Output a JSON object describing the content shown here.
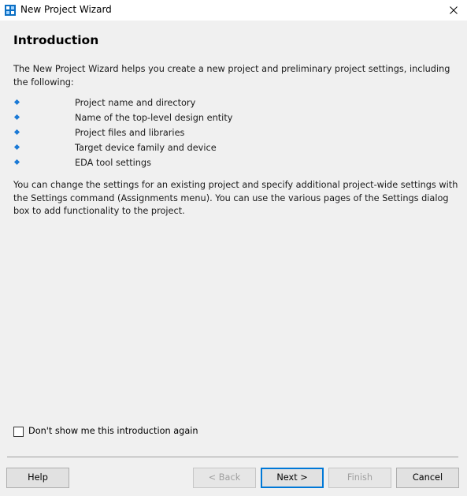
{
  "window": {
    "title": "New Project Wizard"
  },
  "page": {
    "heading": "Introduction",
    "intro_text": "The New Project Wizard helps you create a new project and preliminary project settings, including the following:",
    "bullets": [
      "Project name and directory",
      "Name of the top-level design entity",
      "Project files and libraries",
      "Target device family and device",
      "EDA tool settings"
    ],
    "closing_text": "You can change the settings for an existing project and specify additional project-wide settings with the Settings command (Assignments menu). You can use the various pages of the Settings dialog box to add functionality to the project."
  },
  "checkbox": {
    "label": "Don't show me this introduction again",
    "checked": false
  },
  "buttons": {
    "help": "Help",
    "back": "< Back",
    "next": "Next >",
    "finish": "Finish",
    "cancel": "Cancel"
  },
  "colors": {
    "bullet": "#1b7ad6",
    "default_button_border": "#0078d7",
    "background": "#f0f0f0"
  },
  "icons": {
    "app": "project-wizard-icon",
    "close": "close-icon",
    "bullet": "diamond-bullet-icon"
  }
}
